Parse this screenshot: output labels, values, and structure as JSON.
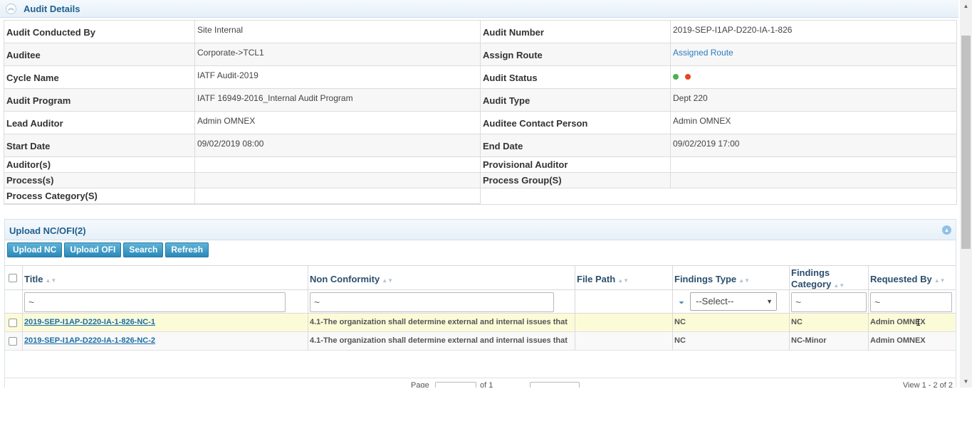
{
  "audit_details": {
    "title": "Audit Details",
    "rows": [
      {
        "label1": "Audit Conducted By",
        "value1": "Site Internal",
        "label2": "Audit Number",
        "value2": "2019-SEP-I1AP-D220-IA-1-826"
      },
      {
        "label1": "Auditee",
        "value1": "Corporate->TCL1",
        "label2": "Assign Route",
        "value2": "Assigned Route"
      },
      {
        "label1": "Cycle Name",
        "value1": "IATF Audit-2019",
        "label2": "Audit Status",
        "value2": ""
      },
      {
        "label1": "Audit Program",
        "value1": "IATF 16949-2016_Internal Audit Program",
        "label2": "Audit Type",
        "value2": "Dept 220"
      },
      {
        "label1": "Lead Auditor",
        "value1": "Admin OMNEX",
        "label2": "Auditee Contact Person",
        "value2": "Admin OMNEX"
      },
      {
        "label1": "Start Date",
        "value1": "09/02/2019 08:00",
        "label2": "End Date",
        "value2": "09/02/2019 17:00"
      },
      {
        "label1": "Auditor(s)",
        "value1": "",
        "label2": "Provisional Auditor",
        "value2": ""
      },
      {
        "label1": "Process(s)",
        "value1": "",
        "label2": "Process Group(S)",
        "value2": ""
      },
      {
        "label1": "Process Category(S)",
        "value1": "",
        "label2": "",
        "value2": ""
      }
    ],
    "status_colors": {
      "green": "#4caf50",
      "red": "#e8461e"
    }
  },
  "upload": {
    "title": "Upload NC/OFI(2)",
    "buttons": [
      "Upload NC",
      "Upload OFI",
      "Search",
      "Refresh"
    ],
    "columns": {
      "title": "Title",
      "non_conformity": "Non Conformity",
      "file_path": "File Path",
      "findings_type": "Findings Type",
      "findings_category_line1": "Findings",
      "findings_category_line2": "Category",
      "requested_by": "Requested By"
    },
    "filters": {
      "title": "~",
      "non_conformity": "~",
      "findings_type": "--Select--",
      "findings_category": "~",
      "requested_by": "~"
    },
    "rows": [
      {
        "title": "2019-SEP-I1AP-D220-IA-1-826-NC-1",
        "non_conformity": "4.1-The organization shall determine external and internal issues that",
        "file_path": "",
        "findings_type": "NC",
        "findings_category": "NC",
        "requested_by": "Admin OMNEX"
      },
      {
        "title": "2019-SEP-I1AP-D220-IA-1-826-NC-2",
        "non_conformity": "4.1-The organization shall determine external and internal issues that",
        "file_path": "",
        "findings_type": "NC",
        "findings_category": "NC-Minor",
        "requested_by": "Admin OMNEX"
      }
    ],
    "pager": {
      "page_label": "Page",
      "of_label": "of 1",
      "view_label": "View 1 - 2 of 2"
    }
  }
}
